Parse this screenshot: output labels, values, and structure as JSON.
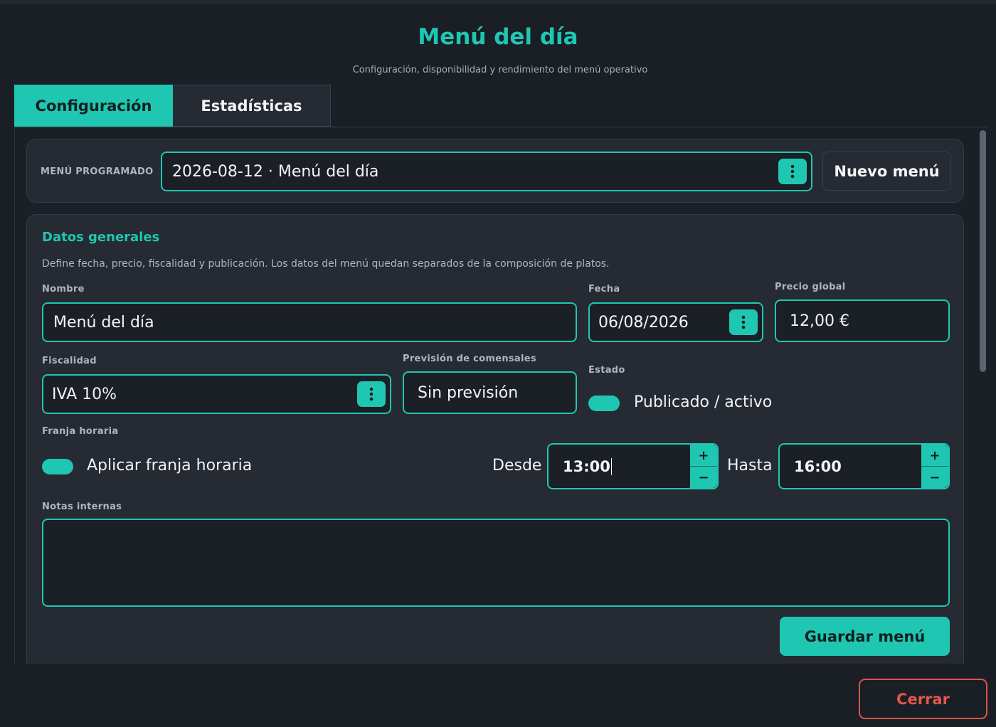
{
  "header": {
    "title": "Menú del día",
    "subtitle": "Configuración, disponibilidad y rendimiento del menú operativo"
  },
  "tabs": [
    {
      "label": "Configuración",
      "active": true
    },
    {
      "label": "Estadísticas",
      "active": false
    }
  ],
  "menu_selector": {
    "label": "MENÚ PROGRAMADO",
    "value": "2026-08-12 · Menú del día",
    "new_button": "Nuevo menú"
  },
  "datos": {
    "title": "Datos generales",
    "description": "Define fecha, precio, fiscalidad y publicación. Los datos del menú quedan separados de la composición de platos.",
    "nombre": {
      "label": "Nombre",
      "value": "Menú del día"
    },
    "fecha": {
      "label": "Fecha",
      "value": "06/08/2026"
    },
    "precio": {
      "label": "Precio global",
      "value": "12,00 €"
    },
    "fiscalidad": {
      "label": "Fiscalidad",
      "value": "IVA 10%"
    },
    "comensales": {
      "label": "Previsión de comensales",
      "value": "Sin previsión"
    },
    "estado": {
      "label": "Estado",
      "toggle_label": "Publicado / activo",
      "on": true
    },
    "franja": {
      "label": "Franja horaria",
      "toggle_label": "Aplicar franja horaria",
      "on": true,
      "desde_label": "Desde",
      "desde_value": "13:00",
      "hasta_label": "Hasta",
      "hasta_value": "16:00",
      "plus": "+",
      "minus": "−"
    },
    "notas": {
      "label": "Notas internas",
      "value": ""
    },
    "save_button": "Guardar menú"
  },
  "footer": {
    "close_button": "Cerrar"
  },
  "colors": {
    "accent": "#1fc7b2",
    "danger": "#e0584b",
    "background": "#1a1e25",
    "card": "#252a33"
  }
}
